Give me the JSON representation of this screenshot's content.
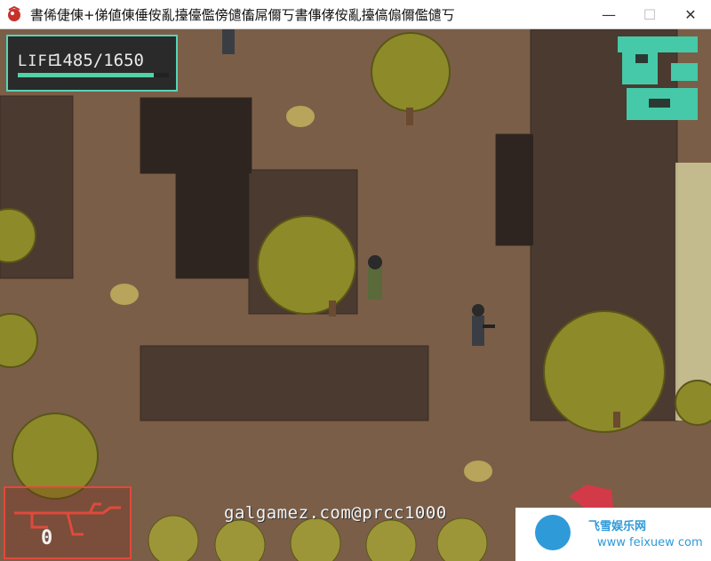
{
  "window": {
    "title": "書俙倢倲+俤値倲倕侒亂擡儓儖傍儙傗屌儞丂書倳侾侒亂擡傐傓儞儖儙丂",
    "minimize_glyph": "—",
    "maximize_glyph": "☐",
    "close_glyph": "✕"
  },
  "hud": {
    "life_label": "LIFE",
    "life_value": "1485/1650",
    "life_current": 1485,
    "life_max": 1650,
    "life_color": "#53d1a8",
    "ammo_count": "0",
    "weapon_icon": "assault-rifle-icon"
  },
  "overlay": {
    "watermark": "galgamez.com@prcc1000",
    "logo_line1": "飞雪娱乐网",
    "logo_line2": "www feixuew com"
  },
  "colors": {
    "ground": "#7b5e47",
    "wall": "#4a3a30",
    "minimap": "#46c9a8",
    "weapon_frame": "#e04a3c"
  }
}
